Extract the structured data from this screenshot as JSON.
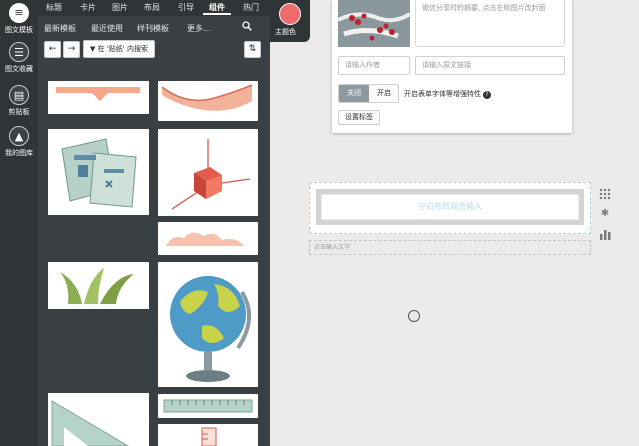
{
  "rail": {
    "items": [
      {
        "label": "图文模板",
        "icon": "list-icon"
      },
      {
        "label": "图文收藏",
        "icon": "bookmark-list-icon"
      },
      {
        "label": "剪贴板",
        "icon": "clipboard-icon"
      },
      {
        "label": "我的图库",
        "icon": "image-gallery-icon"
      }
    ]
  },
  "tabs_primary": [
    "标题",
    "卡片",
    "图片",
    "布局",
    "引导",
    "组件",
    "热门"
  ],
  "tabs_primary_active": "组件",
  "tabs_secondary": [
    "最新模板",
    "最近使用",
    "样刊模板",
    "更多..."
  ],
  "toolbar": {
    "prev": "←",
    "next": "→",
    "search_in": "▼ 在 '贴纸' 内搜索",
    "sort": "⇅"
  },
  "theme_color": {
    "label": "主题色",
    "color": "#f06c6c"
  },
  "editor_card": {
    "summary_placeholder": "微信分享时的摘要, 点击左侧图片改封面",
    "author_placeholder": "请输入作者",
    "source_placeholder": "请输入原文链接",
    "toggle_off": "关闭",
    "toggle_on": "开启",
    "toggle_label": "开启表单字体等增强特性",
    "help_icon": "?",
    "set_tag": "设置标签"
  },
  "canvas": {
    "block_placeholder": "空白布局双击输入",
    "caption_placeholder": "点击输入文字"
  },
  "side_tools": [
    "drag-grid-icon",
    "settings-asterisk-icon",
    "bar-chart-icon"
  ],
  "colors": {
    "rail_bg": "#2f3437",
    "panel_bg": "#3a3f44",
    "accent": "#f06c6c",
    "block_text": "#b7d9e6"
  }
}
